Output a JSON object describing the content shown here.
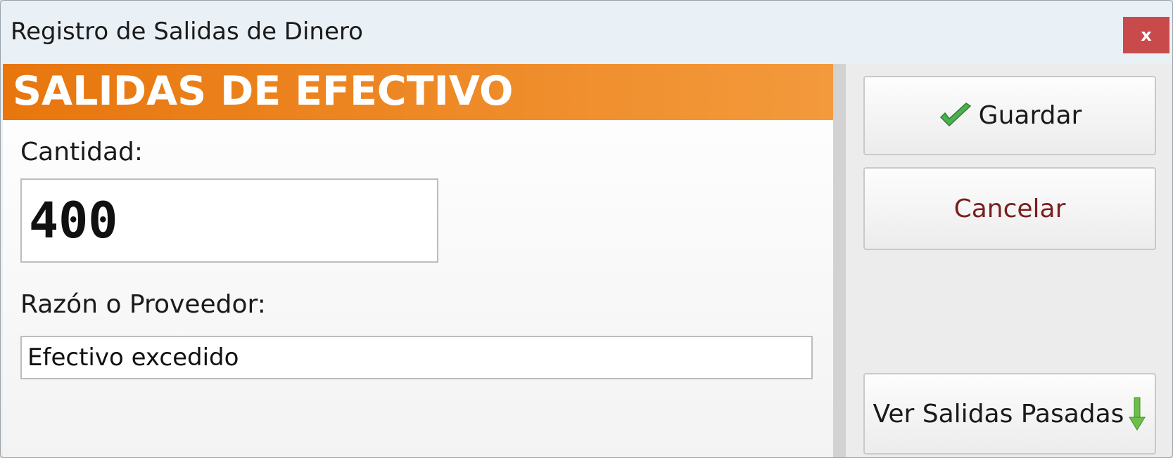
{
  "window": {
    "title": "Registro de Salidas de Dinero",
    "close_label": "x"
  },
  "header": {
    "title": "SALIDAS DE EFECTIVO"
  },
  "form": {
    "amount_label": "Cantidad:",
    "amount_value": "400",
    "reason_label": "Razón o Proveedor:",
    "reason_value": "Efectivo excedido"
  },
  "actions": {
    "save_label": "Guardar",
    "cancel_label": "Cancelar",
    "history_label": "Ver Salidas Pasadas"
  },
  "icons": {
    "save": "check-icon",
    "history": "arrow-down-icon"
  },
  "colors": {
    "header_start": "#e8760d",
    "header_end": "#f39a3c",
    "close_button": "#c94a4a",
    "cancel_text": "#7a1e1e",
    "check_green": "#4caf50"
  }
}
